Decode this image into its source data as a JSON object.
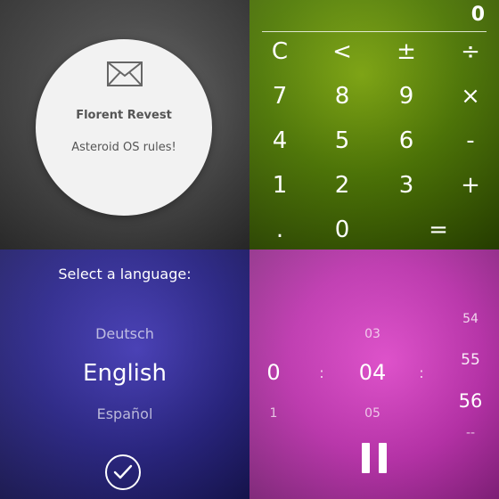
{
  "notification": {
    "icon": "envelope-icon",
    "title": "Florent Revest",
    "body": "Asteroid OS rules!"
  },
  "calculator": {
    "display": "0",
    "keys": [
      "C",
      "<",
      "±",
      "÷",
      "7",
      "8",
      "9",
      "×",
      "4",
      "5",
      "6",
      "-",
      "1",
      "2",
      "3",
      "+",
      ".",
      "0",
      "="
    ]
  },
  "language": {
    "title": "Select a language:",
    "options": [
      "Deutsch",
      "English",
      "Español"
    ],
    "selected": "English",
    "confirm_icon": "checkmark-icon"
  },
  "timer": {
    "hours": {
      "prev": "",
      "current": "0",
      "next": "1"
    },
    "minutes": {
      "prev": "03",
      "current": "04",
      "next": "05"
    },
    "seconds": {
      "prev2": "54",
      "prev": "55",
      "current": "56",
      "next": "--"
    },
    "separator": ":",
    "control_icon": "pause-icon"
  },
  "colors": {
    "notification_bg": "#f2f2f2",
    "calculator_bg": "#5a8a00",
    "language_bg": "#2b2690",
    "timer_bg": "#c02fb0"
  }
}
